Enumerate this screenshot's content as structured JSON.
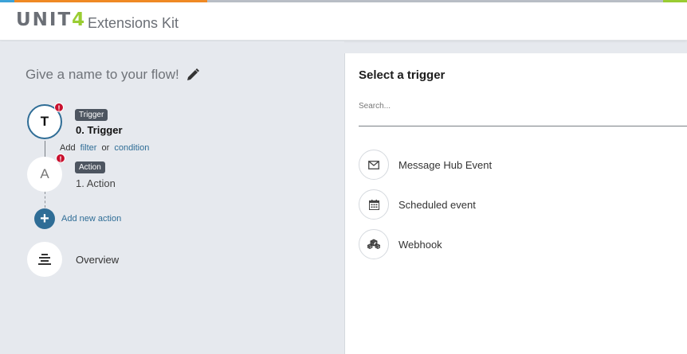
{
  "header": {
    "logo_prefix": "UNIT",
    "logo_suffix": "4",
    "app_title": "Extensions Kit"
  },
  "flow": {
    "name_placeholder": "Give a name to your flow!",
    "trigger": {
      "node_letter": "T",
      "badge": "Trigger",
      "title": "0. Trigger",
      "error_mark": "!"
    },
    "add_row": {
      "add": "Add",
      "filter": "filter",
      "or": "or",
      "condition": "condition"
    },
    "action": {
      "node_letter": "A",
      "badge": "Action",
      "title": "1. Action",
      "error_mark": "!"
    },
    "add_new_action": {
      "symbol": "+",
      "label": "Add new action"
    },
    "overview": {
      "label": "Overview",
      "icon": "overview-icon"
    }
  },
  "trigger_panel": {
    "title": "Select a trigger",
    "search_placeholder": "Search...",
    "items": [
      {
        "label": "Message Hub Event",
        "icon": "envelope-icon"
      },
      {
        "label": "Scheduled event",
        "icon": "calendar-icon"
      },
      {
        "label": "Webhook",
        "icon": "webhook-icon"
      }
    ]
  },
  "colors": {
    "accent_blue": "#2f6d96",
    "error_red": "#c8102e",
    "logo_green": "#9acd32",
    "panel_background": "#e6e9ee"
  }
}
